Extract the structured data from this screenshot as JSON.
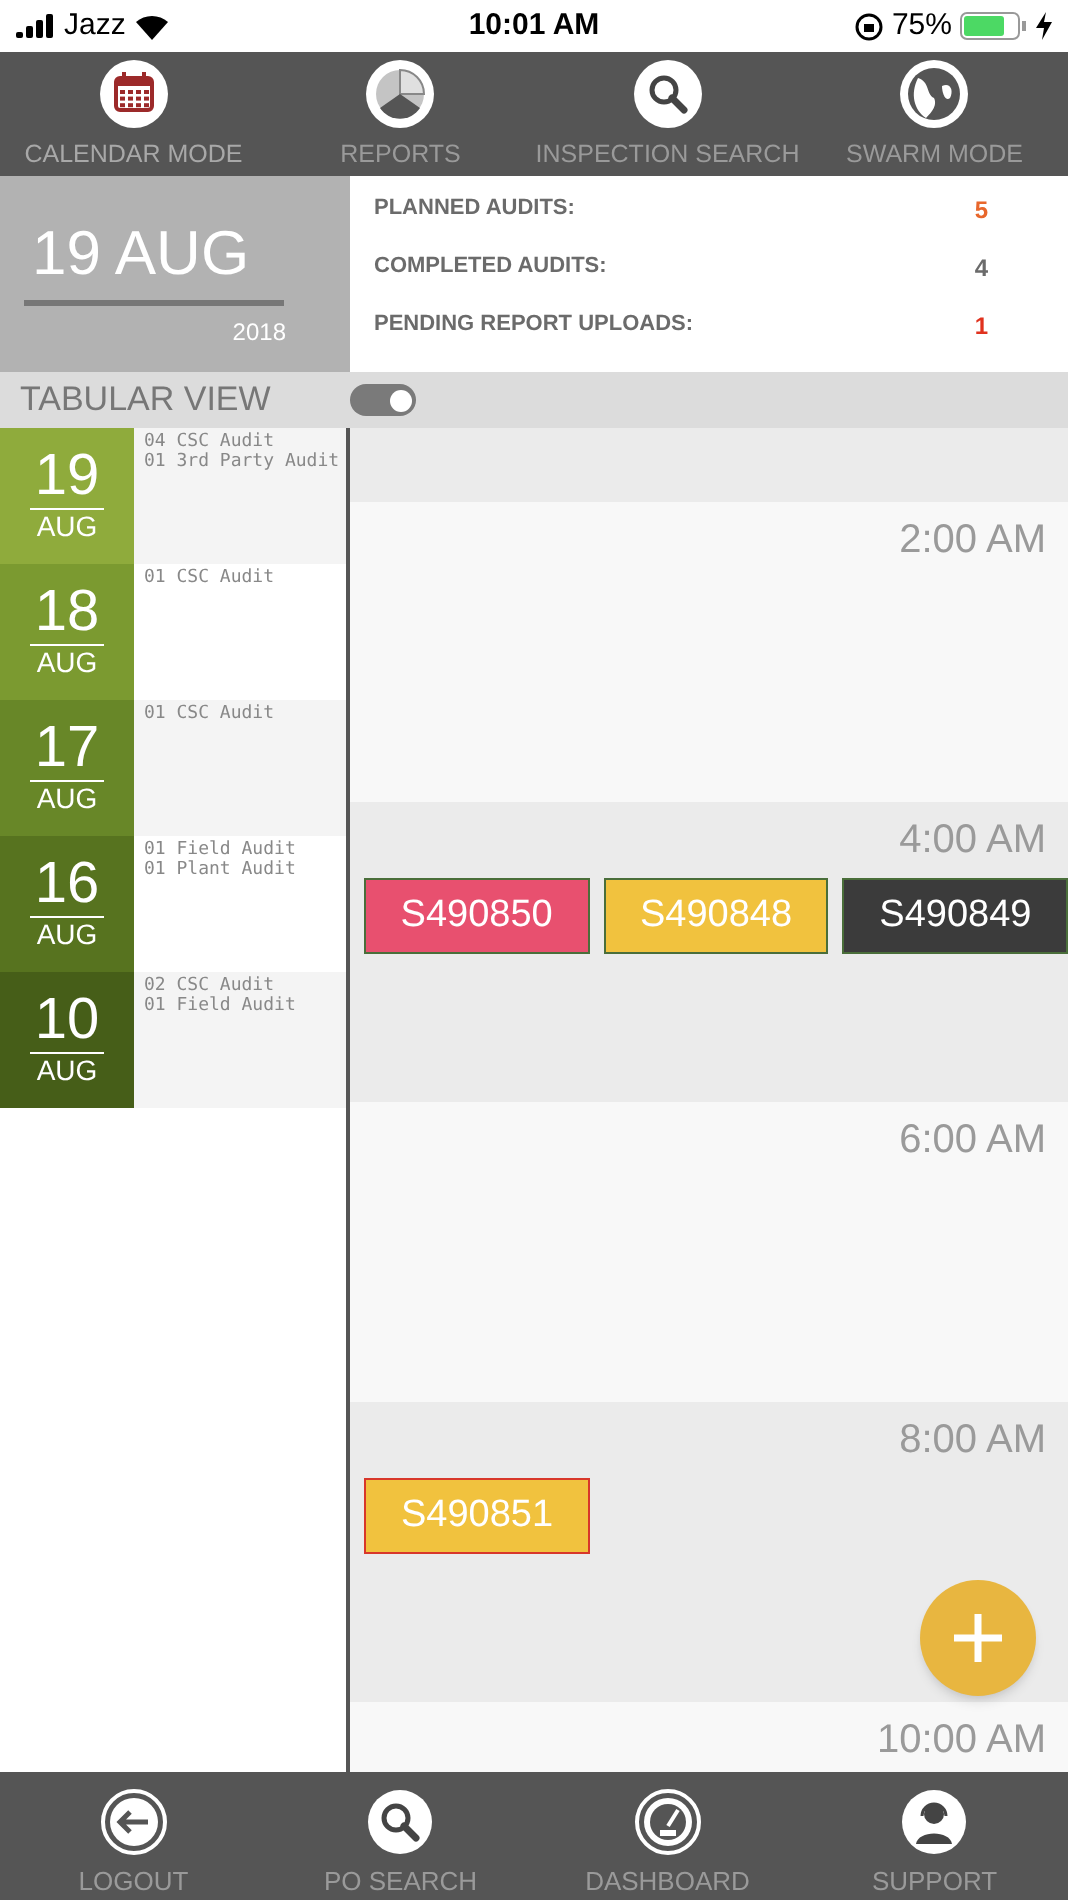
{
  "status_bar": {
    "carrier": "Jazz",
    "time": "10:01 AM",
    "battery": "75%"
  },
  "top_nav": [
    {
      "label": "CALENDAR MODE",
      "selected": true
    },
    {
      "label": "REPORTS",
      "selected": false
    },
    {
      "label": "INSPECTION SEARCH",
      "selected": false
    },
    {
      "label": "SWARM MODE",
      "selected": false
    }
  ],
  "date_header": {
    "day": "19 AUG",
    "year": "2018"
  },
  "stats": [
    {
      "label": "PLANNED AUDITS:",
      "value": "5",
      "color": "#e8672c"
    },
    {
      "label": "COMPLETED AUDITS:",
      "value": "4",
      "color": "#6b6b6b"
    },
    {
      "label": "PENDING REPORT UPLOADS:",
      "value": "1",
      "color": "#e0321e"
    }
  ],
  "tabular_view": {
    "label": "TABULAR VIEW",
    "on": true
  },
  "days": [
    {
      "day": "19",
      "month": "AUG",
      "color": "#8fab3c",
      "audits": [
        "04 CSC Audit",
        "01 3rd Party Audit"
      ]
    },
    {
      "day": "18",
      "month": "AUG",
      "color": "#7b9a30",
      "audits": [
        "01 CSC Audit"
      ]
    },
    {
      "day": "17",
      "month": "AUG",
      "color": "#688728",
      "audits": [
        "01 CSC Audit"
      ]
    },
    {
      "day": "16",
      "month": "AUG",
      "color": "#57731f",
      "audits": [
        "01 Field Audit",
        "01 Plant Audit"
      ]
    },
    {
      "day": "10",
      "month": "AUG",
      "color": "#465e18",
      "audits": [
        "02 CSC Audit",
        "01 Field Audit"
      ]
    }
  ],
  "time_slots": [
    {
      "time": "2:00 AM"
    },
    {
      "time": "4:00 AM",
      "events": [
        {
          "label": "S490850",
          "color": "#e8506f",
          "flagged": false
        },
        {
          "label": "S490848",
          "color": "#f1c23e",
          "flagged": false
        },
        {
          "label": "S490849",
          "color": "#3b3b3b",
          "flagged": false
        }
      ]
    },
    {
      "time": "6:00 AM"
    },
    {
      "time": "8:00 AM",
      "events": [
        {
          "label": "S490851",
          "color": "#f1c23e",
          "flagged": true
        }
      ]
    },
    {
      "time": "10:00 AM"
    }
  ],
  "bottom_nav": [
    {
      "label": "LOGOUT"
    },
    {
      "label": "PO SEARCH"
    },
    {
      "label": "DASHBOARD"
    },
    {
      "label": "SUPPORT"
    }
  ]
}
